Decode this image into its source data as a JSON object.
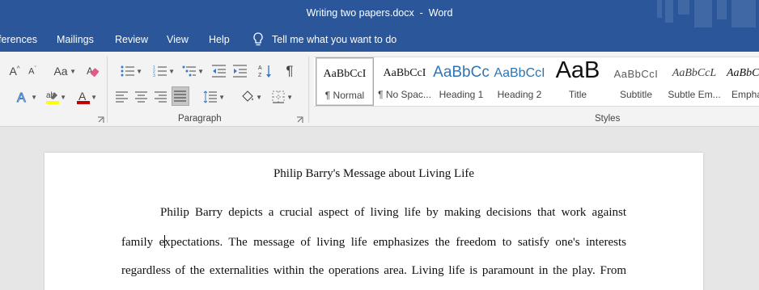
{
  "window": {
    "title": "Writing two papers.docx  -  Word"
  },
  "tabs": [
    {
      "label": "ferences"
    },
    {
      "label": "Mailings"
    },
    {
      "label": "Review"
    },
    {
      "label": "View"
    },
    {
      "label": "Help"
    }
  ],
  "tell_me": {
    "label": "Tell me what you want to do"
  },
  "ribbon": {
    "paragraph_group_label": "Paragraph",
    "styles_group_label": "Styles",
    "font_case_glyph": "Aa",
    "pilcrow_glyph": "¶"
  },
  "styles": [
    {
      "preview": "AaBbCcI",
      "name": "¶ Normal"
    },
    {
      "preview": "AaBbCcI",
      "name": "¶ No Spac..."
    },
    {
      "preview": "AaBbCc",
      "name": "Heading 1"
    },
    {
      "preview": "AaBbCcI",
      "name": "Heading 2"
    },
    {
      "preview": "AaB",
      "name": "Title"
    },
    {
      "preview": "AaBbCcI",
      "name": "Subtitle"
    },
    {
      "preview": "AaBbCcL",
      "name": "Subtle Em..."
    },
    {
      "preview": "AaBbCcI",
      "name": "Empha"
    }
  ],
  "colors": {
    "word_blue": "#2b579a",
    "highlight_yellow": "#ffff00",
    "font_color_red": "#c00000",
    "heading_blue": "#2e74b5"
  },
  "document": {
    "title": "Philip Barry's Message about Living Life",
    "line1": "Philip Barry depicts a crucial aspect of living life by making decisions that work against",
    "line2_before_caret": "family e",
    "line2_after_caret": "xpectations. The message of living life emphasizes the freedom to satisfy one's interests",
    "line3": "regardless of the externalities within the operations area. Living life is paramount in the play. From"
  }
}
